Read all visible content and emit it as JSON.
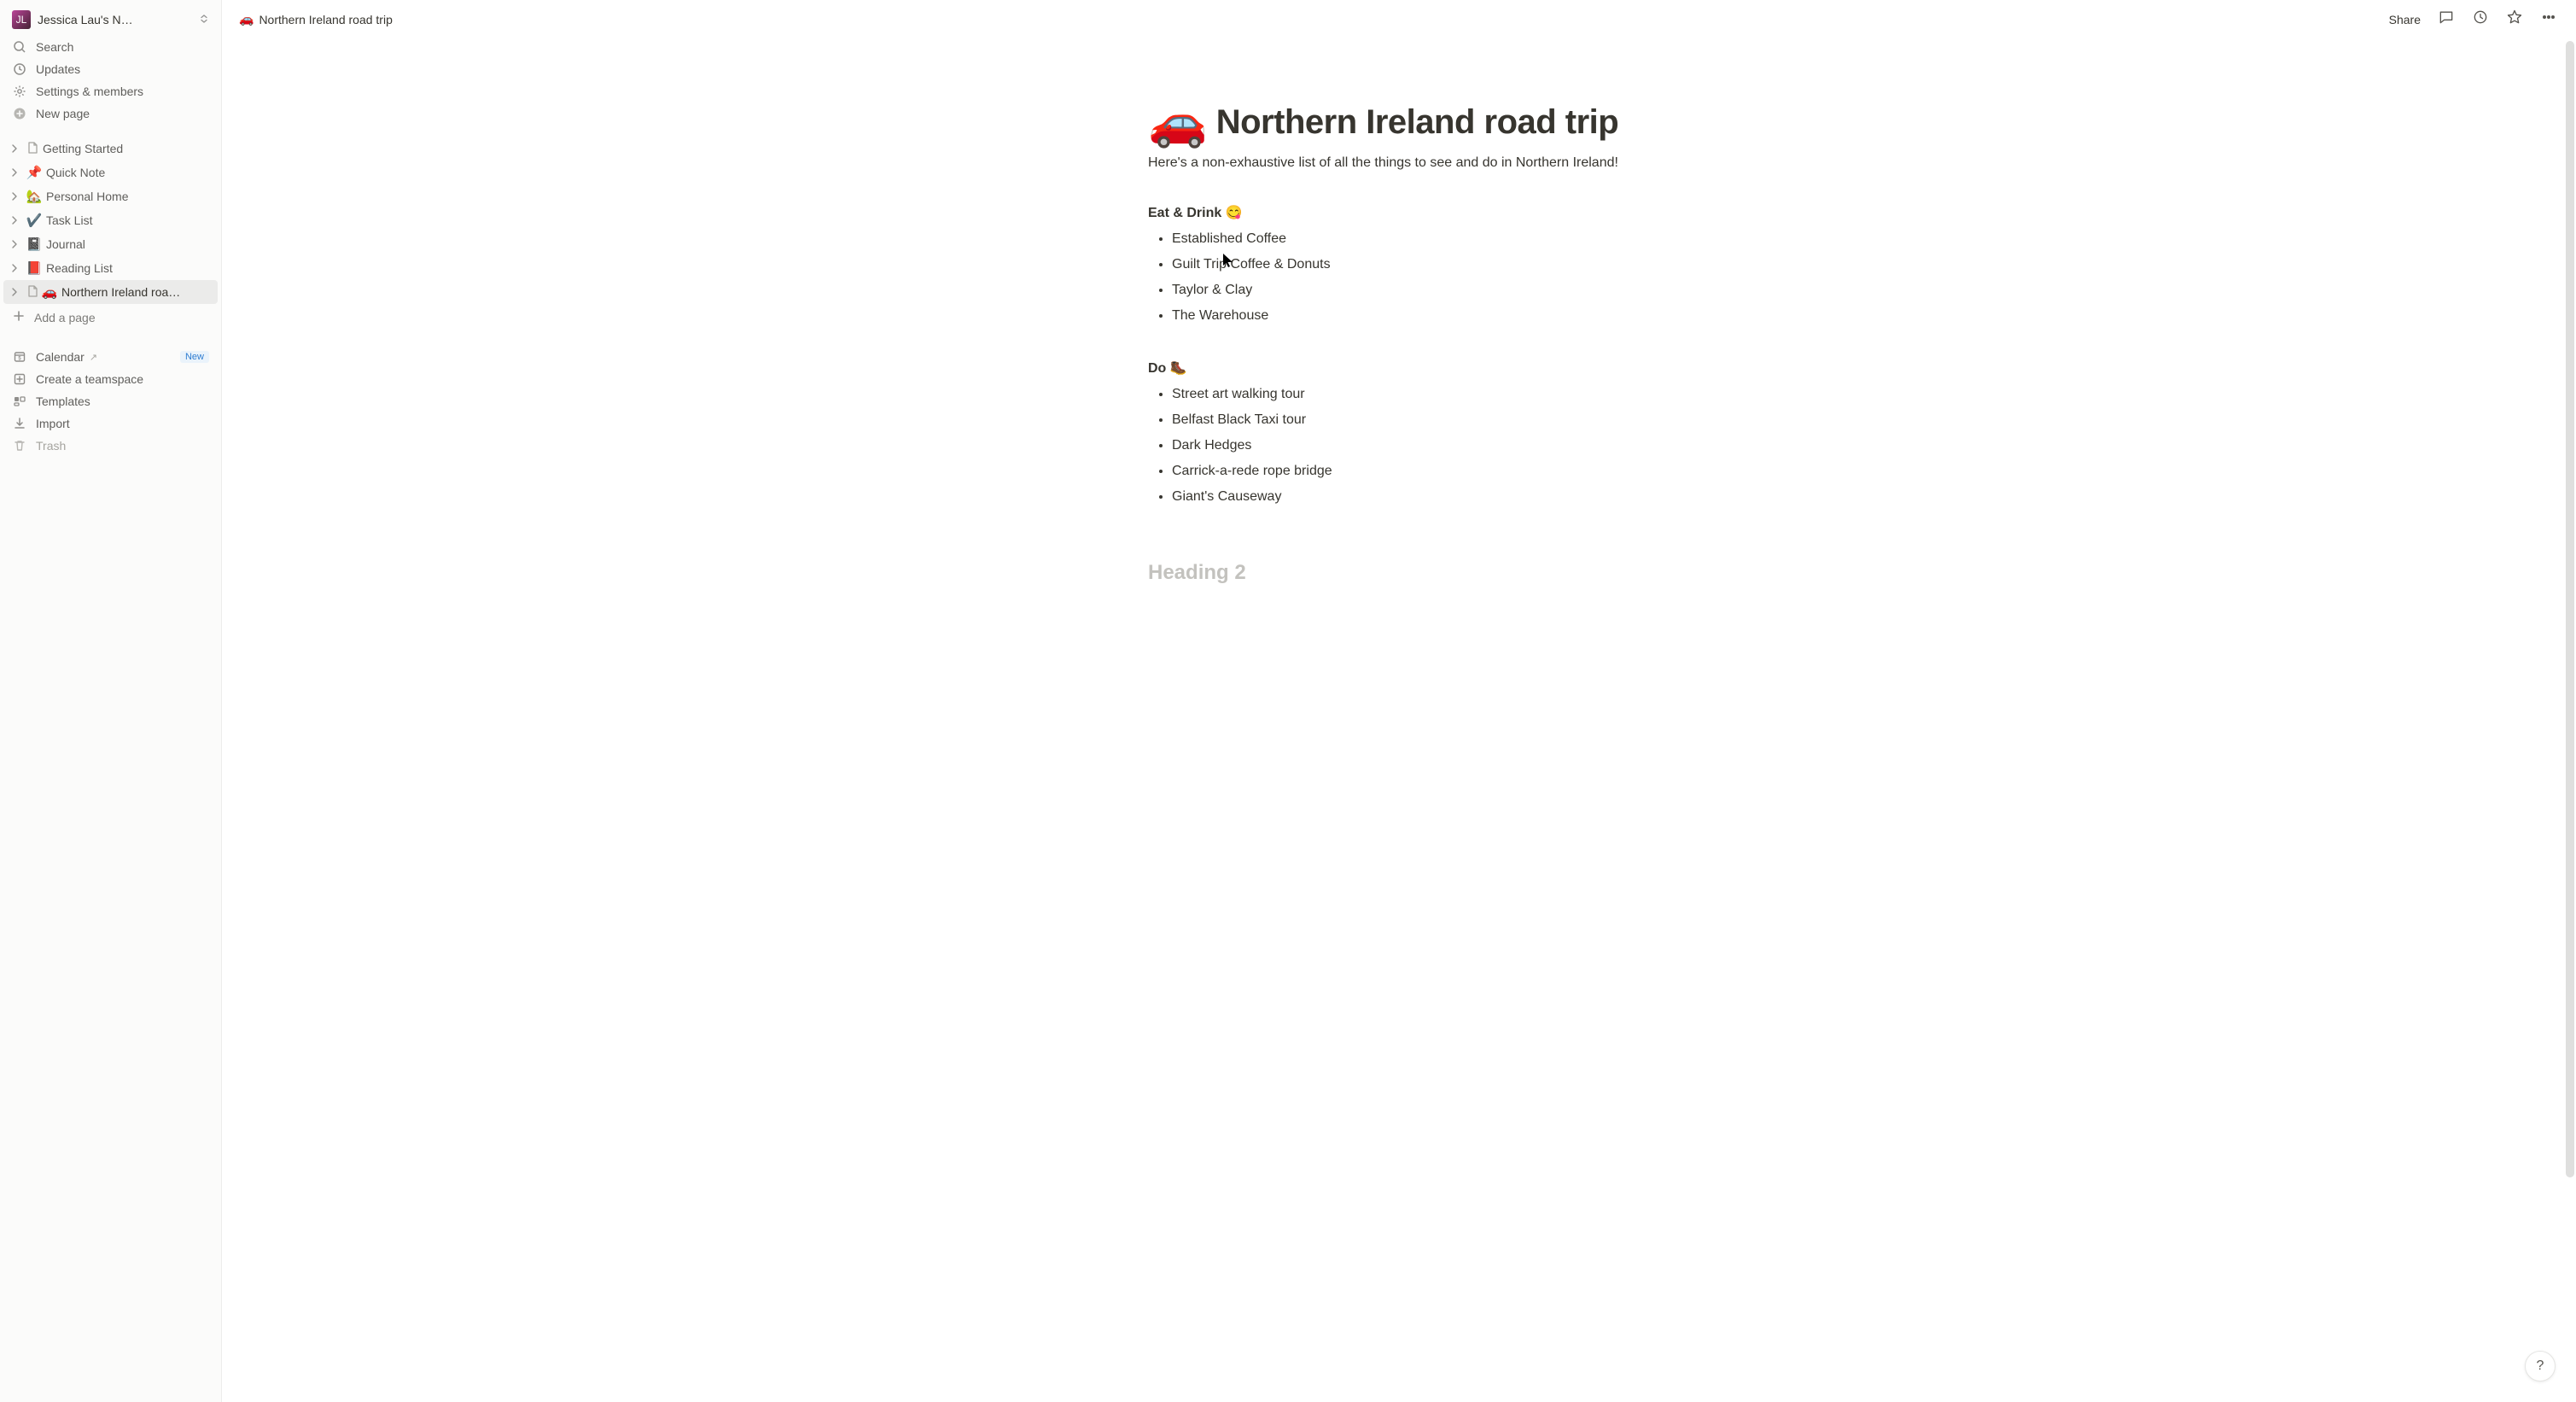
{
  "workspace": {
    "name": "Jessica Lau's N…"
  },
  "nav": {
    "search": "Search",
    "updates": "Updates",
    "settings": "Settings & members",
    "new_page": "New page"
  },
  "pages": [
    {
      "emoji": "",
      "doc": true,
      "label": "Getting Started",
      "active": false
    },
    {
      "emoji": "📌",
      "doc": false,
      "label": "Quick Note",
      "active": false
    },
    {
      "emoji": "🏡",
      "doc": false,
      "label": "Personal Home",
      "active": false
    },
    {
      "emoji": "✔️",
      "doc": false,
      "label": "Task List",
      "active": false
    },
    {
      "emoji": "📓",
      "doc": false,
      "label": "Journal",
      "active": false
    },
    {
      "emoji": "📕",
      "doc": false,
      "label": "Reading List",
      "active": false
    },
    {
      "emoji": "🚗",
      "doc": true,
      "label": "Northern Ireland roa…",
      "active": true
    }
  ],
  "add_page": "Add a page",
  "tools": {
    "calendar": "Calendar",
    "calendar_badge": "New",
    "teamspace": "Create a teamspace",
    "templates": "Templates",
    "import": "Import",
    "trash": "Trash"
  },
  "topbar": {
    "breadcrumb_emoji": "🚗",
    "breadcrumb": "Northern Ireland road trip",
    "share": "Share"
  },
  "page": {
    "emoji": "🚗",
    "title": "Northern Ireland road trip",
    "intro": "Here's a non-exhaustive list of all the things to see and do in Northern Ireland!",
    "sections": [
      {
        "heading": "Eat & Drink 😋",
        "items": [
          "Established Coffee",
          "Guilt Trip Coffee & Donuts",
          "Taylor & Clay",
          "The Warehouse"
        ]
      },
      {
        "heading": "Do 🥾",
        "items": [
          "Street art walking tour",
          "Belfast Black Taxi tour",
          "Dark Hedges",
          "Carrick-a-rede rope bridge",
          "Giant's Causeway"
        ]
      }
    ],
    "placeholder": "Heading 2"
  },
  "help": "?"
}
